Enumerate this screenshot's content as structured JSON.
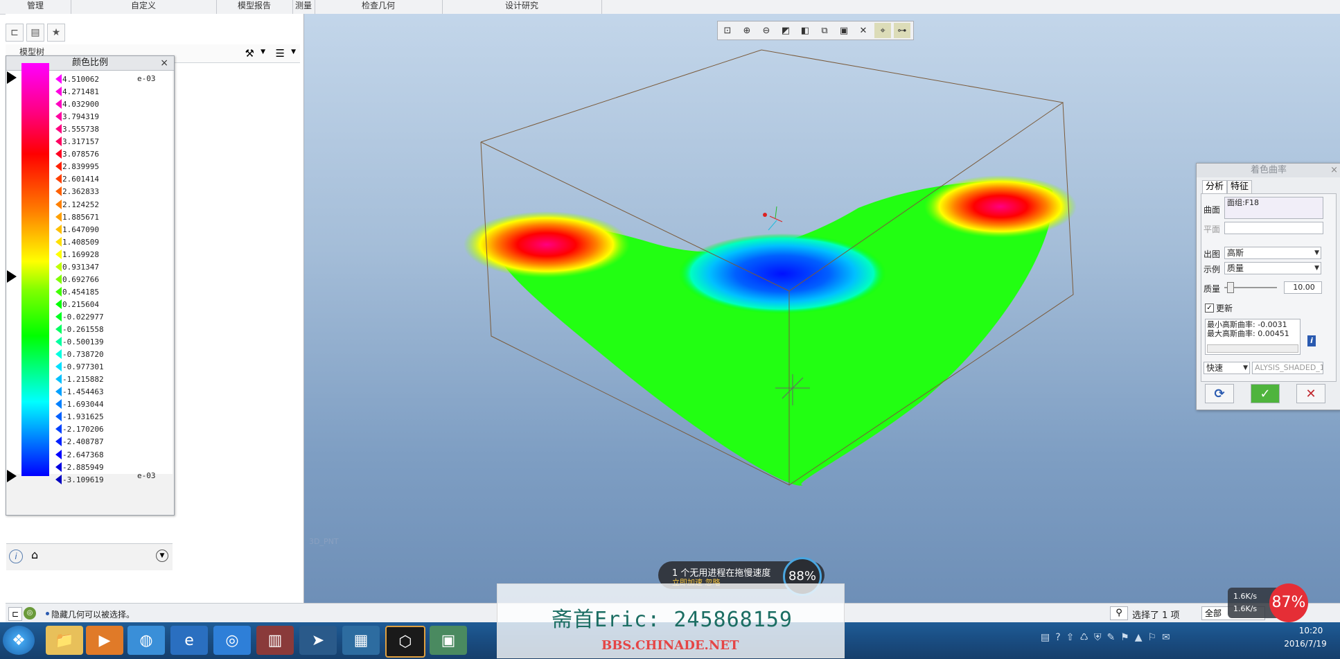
{
  "top_tabs": [
    "管理",
    "自定义",
    "模型报告",
    "测量",
    "检查几何",
    "设计研究"
  ],
  "model_tree_label": "模型树",
  "color_scale": {
    "title": "颜色比例",
    "close": "×",
    "exponent_top": "e-03",
    "exponent_bottom": "e-03",
    "values": [
      "4.510062",
      "4.271481",
      "4.032900",
      "3.794319",
      "3.555738",
      "3.317157",
      "3.078576",
      "2.839995",
      "2.601414",
      "2.362833",
      "2.124252",
      "1.885671",
      "1.647090",
      "1.408509",
      "1.169928",
      "0.931347",
      "0.692766",
      "0.454185",
      "0.215604",
      "-0.022977",
      "-0.261558",
      "-0.500139",
      "-0.738720",
      "-0.977301",
      "-1.215882",
      "-1.454463",
      "-1.693044",
      "-1.931625",
      "-2.170206",
      "-2.408787",
      "-2.647368",
      "-2.885949",
      "-3.109619"
    ],
    "colors": [
      "#ff00ff",
      "#ff00e0",
      "#ff00c0",
      "#ff00a0",
      "#ff0080",
      "#ff0060",
      "#ff0020",
      "#ff2000",
      "#ff4000",
      "#ff6000",
      "#ff8000",
      "#ffa000",
      "#ffc000",
      "#ffe000",
      "#ffff00",
      "#c0ff00",
      "#80ff00",
      "#40ff00",
      "#00ff00",
      "#00ff20",
      "#00ff60",
      "#00ffa0",
      "#00ffe0",
      "#00e0ff",
      "#00c0ff",
      "#00a0ff",
      "#0080ff",
      "#0060ff",
      "#0040ff",
      "#0020ff",
      "#0000ff",
      "#0000e0",
      "#0000c0"
    ]
  },
  "view_angle_label": "3D_PNT",
  "dialog": {
    "title": "着色曲率",
    "close": "×",
    "tab_analysis": "分析",
    "tab_feature": "特征",
    "surface_label": "曲面",
    "surface_value": "面组:F18",
    "plane_label": "平面",
    "output_label": "出图",
    "output_value": "高斯",
    "sample_label": "示例",
    "sample_value": "质量",
    "quality_label": "质量",
    "quality_value": "10.00",
    "update_label": "更新",
    "min_label": "最小高斯曲率: -0.0031",
    "max_label": "最大高斯曲率: 0.00451",
    "mode_value": "快速",
    "name_value": "ALYSIS_SHADED_1"
  },
  "status": {
    "message": "隐藏几何可以被选择。",
    "selected": "选择了 1 项",
    "filter": "全部"
  },
  "popup": {
    "text": "1 个无用进程在拖慢速度",
    "sub": "立即加速    忽略",
    "gauge": "88%"
  },
  "watermark": {
    "name": "斋首Eric: 245868159",
    "site": "BBS.CHINADE.NET"
  },
  "network": {
    "up": "1.6K/s",
    "down": "1.6K/s",
    "percent": "87%"
  },
  "clock": {
    "time": "10:20",
    "date": "2016/7/19"
  }
}
